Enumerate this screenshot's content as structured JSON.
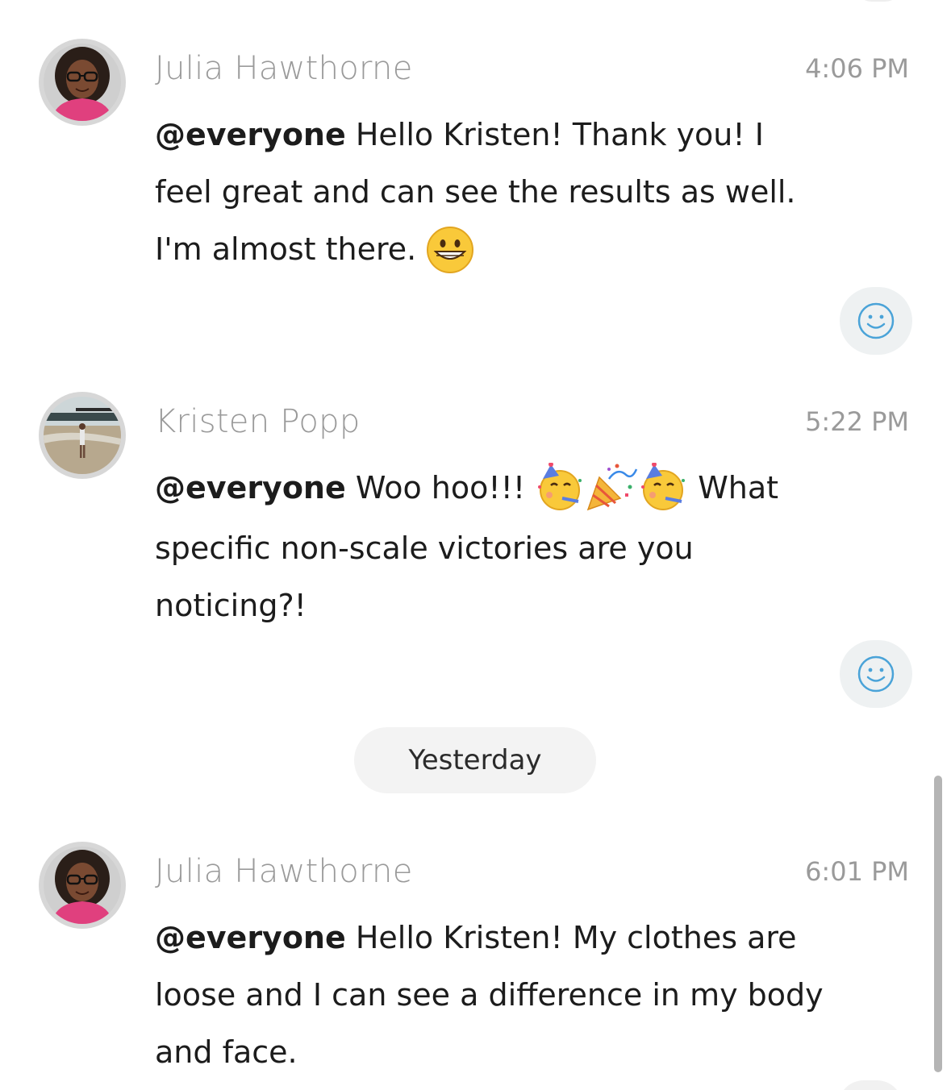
{
  "messages": [
    {
      "sender": "Julia Hawthorne",
      "time": "4:06 PM",
      "mention": "@everyone",
      "text_line1": " Hello Kristen! Thank you! I",
      "text_line2": "feel great and can see the results as well.",
      "text_line3": "I'm almost there. ",
      "avatar_icon": "woman-glasses-pink-shirt-avatar",
      "emoji_icon": "grinning-face-icon",
      "react_icon": "add-reaction-smiley-icon"
    },
    {
      "sender": "Kristen Popp",
      "time": "5:22 PM",
      "mention": "@everyone",
      "text_line1a": " Woo hoo!!! ",
      "text_line1b": " What",
      "text_line2": "specific non-scale victories are you",
      "text_line3": "noticing?!",
      "avatar_icon": "beach-photo-avatar",
      "emoji_icons": [
        "partying-face-icon",
        "party-popper-icon",
        "partying-face-icon"
      ],
      "react_icon": "add-reaction-smiley-icon"
    },
    {
      "sender": "Julia Hawthorne",
      "time": "6:01 PM",
      "mention": "@everyone",
      "text_line1": " Hello Kristen! My clothes are",
      "text_line2": "loose and I can see a difference in my body",
      "text_line3": "and face.",
      "avatar_icon": "woman-glasses-pink-shirt-avatar"
    }
  ],
  "date_separator": "Yesterday",
  "colors": {
    "sender_gray": "#9a9a9a",
    "react_bg": "#eef1f2",
    "react_icon": "#4aa3d8",
    "pill_bg": "#f3f3f3",
    "scrollbar": "#b5b5b5"
  }
}
